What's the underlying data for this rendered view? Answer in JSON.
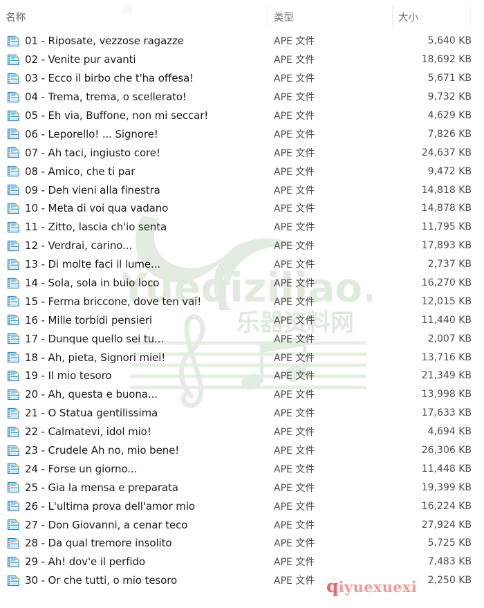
{
  "window": {
    "type": "file-explorer-list-view"
  },
  "columns": {
    "name": "名称",
    "type": "类型",
    "size": "大小"
  },
  "watermarks": {
    "green_text": "Yueqiziliao.com",
    "green_subtext": "乐器资料网",
    "top_faint": "网",
    "red_mark_lead": "q",
    "red_mark_rest": "iyuexuexi"
  },
  "icon": {
    "name": "ape-audio-file-icon"
  },
  "files": [
    {
      "name": "01 - Riposate, vezzose ragazze",
      "type": "APE 文件",
      "size": "5,640 KB"
    },
    {
      "name": "02 - Venite pur avanti",
      "type": "APE 文件",
      "size": "18,692 KB"
    },
    {
      "name": "03 - Ecco il birbo che t'ha offesa!",
      "type": "APE 文件",
      "size": "5,671 KB"
    },
    {
      "name": "04 - Trema, trema, o scellerato!",
      "type": "APE 文件",
      "size": "9,732 KB"
    },
    {
      "name": "05 - Eh via, Buffone, non mi seccar!",
      "type": "APE 文件",
      "size": "4,629 KB"
    },
    {
      "name": "06 - Leporello! ... Signore!",
      "type": "APE 文件",
      "size": "7,826 KB"
    },
    {
      "name": "07 - Ah taci, ingiusto core!",
      "type": "APE 文件",
      "size": "24,637 KB"
    },
    {
      "name": "08 - Amico, che ti par",
      "type": "APE 文件",
      "size": "9,472 KB"
    },
    {
      "name": "09 - Deh vieni alla finestra",
      "type": "APE 文件",
      "size": "14,818 KB"
    },
    {
      "name": "10 - Meta di voi qua vadano",
      "type": "APE 文件",
      "size": "14,878 KB"
    },
    {
      "name": "11 - Zitto, lascia ch'io senta",
      "type": "APE 文件",
      "size": "11,795 KB"
    },
    {
      "name": "12 - Verdrai, carino...",
      "type": "APE 文件",
      "size": "17,893 KB"
    },
    {
      "name": "13 - Di molte faci il lume...",
      "type": "APE 文件",
      "size": "2,737 KB"
    },
    {
      "name": "14 - Sola, sola in buio loco",
      "type": "APE 文件",
      "size": "16,270 KB"
    },
    {
      "name": "15 - Ferma briccone, dove ten vai!",
      "type": "APE 文件",
      "size": "12,015 KB"
    },
    {
      "name": "16 - Mille torbidi pensieri",
      "type": "APE 文件",
      "size": "11,440 KB"
    },
    {
      "name": "17 - Dunque quello sei tu...",
      "type": "APE 文件",
      "size": "2,007 KB"
    },
    {
      "name": "18 - Ah, pieta, Signori miei!",
      "type": "APE 文件",
      "size": "13,716 KB"
    },
    {
      "name": "19 - Il mio tesoro",
      "type": "APE 文件",
      "size": "21,349 KB"
    },
    {
      "name": "20 - Ah, questa e  buona...",
      "type": "APE 文件",
      "size": "13,998 KB"
    },
    {
      "name": "21 - O Statua gentilissima",
      "type": "APE 文件",
      "size": "17,633 KB"
    },
    {
      "name": "22 - Calmatevi, idol mio!",
      "type": "APE 文件",
      "size": "4,694 KB"
    },
    {
      "name": "23 - Crudele Ah no, mio bene!",
      "type": "APE 文件",
      "size": "26,306 KB"
    },
    {
      "name": "24 - Forse un giorno...",
      "type": "APE 文件",
      "size": "11,448 KB"
    },
    {
      "name": "25 - Gia la mensa e preparata",
      "type": "APE 文件",
      "size": "19,399 KB"
    },
    {
      "name": "26 - L'ultima prova dell'amor mio",
      "type": "APE 文件",
      "size": "16,224 KB"
    },
    {
      "name": "27 - Don Giovanni, a cenar teco",
      "type": "APE 文件",
      "size": "27,924 KB"
    },
    {
      "name": "28 - Da qual tremore insolito",
      "type": "APE 文件",
      "size": "5,725 KB"
    },
    {
      "name": "29 - Ah! dov'e il perfido",
      "type": "APE 文件",
      "size": "7,483 KB"
    },
    {
      "name": "30 - Or che tutti, o mio tesoro",
      "type": "APE 文件",
      "size": "2,250 KB"
    }
  ],
  "colors": {
    "icon_blue": "#3f9ede",
    "icon_blue_dark": "#1a6fae",
    "icon_corner": "#f5d98a",
    "text_primary": "#1b1b1b",
    "text_secondary": "#4b4b4b",
    "header_text": "#6d6d6d",
    "divider": "#e6e8ea",
    "watermark_green": "#dfe9dc",
    "watermark_red": "#f09a9a"
  }
}
